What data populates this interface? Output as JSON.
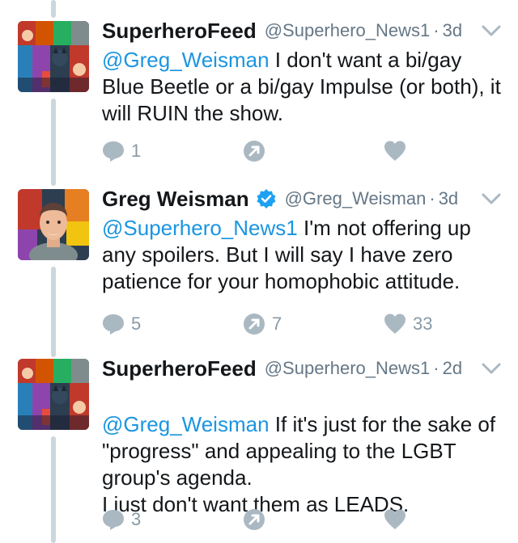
{
  "tweets": [
    {
      "name": "SuperheroFeed",
      "verified": false,
      "handle": "@Superhero_News1",
      "separator": "·",
      "time": "3d",
      "mention": "@Greg_Weisman",
      "text": " I don't want a bi/gay Blue Beetle or a bi/gay Impulse (or both), it will RUIN the show.",
      "reply_count": "1",
      "retweet_count": "",
      "like_count": ""
    },
    {
      "name": "Greg Weisman",
      "verified": true,
      "handle": "@Greg_Weisman",
      "separator": "·",
      "time": "3d",
      "mention": "@Superhero_News1",
      "text": " I'm not offering up any spoilers. But I will say I have zero patience for your homophobic attitude.",
      "reply_count": "5",
      "retweet_count": "7",
      "like_count": "33"
    },
    {
      "name": "SuperheroFeed",
      "verified": false,
      "handle": "@Superhero_News1",
      "separator": "·",
      "time": "2d",
      "mention": "@Greg_Weisman",
      "text": " If it's just for the sake of \"progress\" and appealing to the LGBT group's agenda.\nI just don't want them as LEADS.",
      "reply_count": "3",
      "retweet_count": "",
      "like_count": ""
    }
  ],
  "icons": {
    "reply": "reply-icon",
    "retweet": "retweet-icon",
    "like": "heart-icon",
    "menu": "chevron-down-icon",
    "verified": "verified-badge-icon"
  },
  "colors": {
    "link": "#1b95e0",
    "muted": "#657786",
    "icon": "#aab8c2",
    "thread_line": "#ccd6dd"
  }
}
